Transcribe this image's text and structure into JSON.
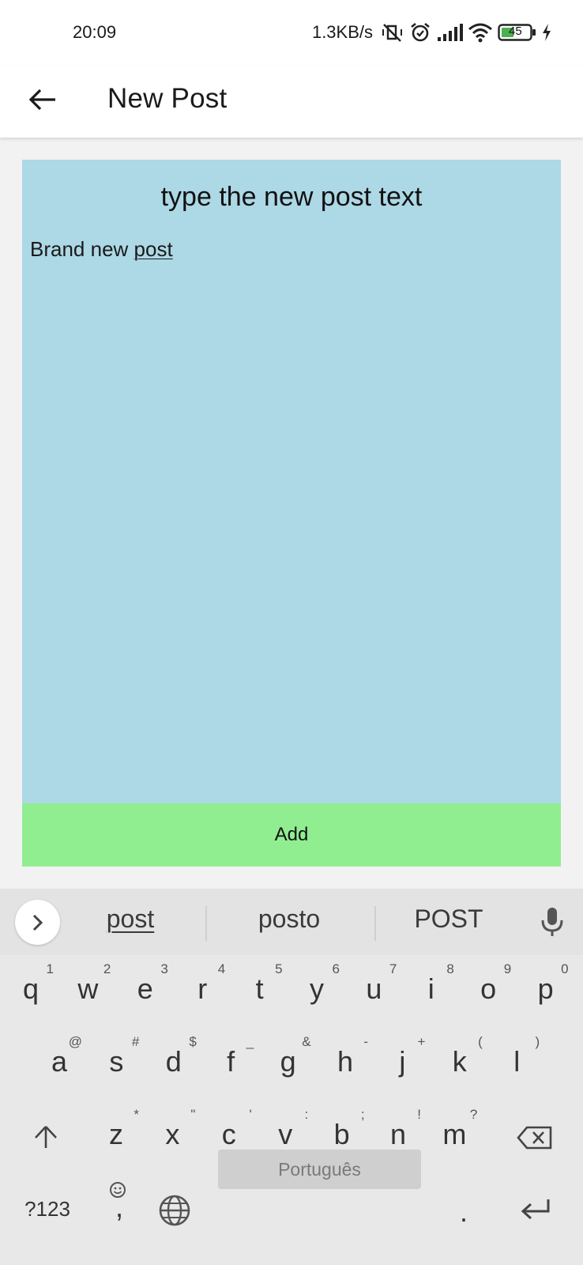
{
  "status_bar": {
    "time": "20:09",
    "net_speed": "1.3KB/s",
    "battery": "45",
    "icons": [
      "vibrate-off-icon",
      "alarm-icon",
      "signal-icon",
      "wifi-icon",
      "battery-icon",
      "charging-icon"
    ]
  },
  "app_bar": {
    "back_icon": "arrow-back-icon",
    "title": "New Post"
  },
  "editor": {
    "heading": "type the new post text",
    "text_prefix": "Brand new ",
    "text_composing": "post",
    "background": "#add8e6"
  },
  "add_button": {
    "label": "Add",
    "background": "#90ee90"
  },
  "keyboard": {
    "suggestions": [
      "post",
      "posto",
      "POST"
    ],
    "row1": [
      {
        "key": "q",
        "sup": "1"
      },
      {
        "key": "w",
        "sup": "2"
      },
      {
        "key": "e",
        "sup": "3"
      },
      {
        "key": "r",
        "sup": "4"
      },
      {
        "key": "t",
        "sup": "5"
      },
      {
        "key": "y",
        "sup": "6"
      },
      {
        "key": "u",
        "sup": "7"
      },
      {
        "key": "i",
        "sup": "8"
      },
      {
        "key": "o",
        "sup": "9"
      },
      {
        "key": "p",
        "sup": "0"
      }
    ],
    "row2": [
      {
        "key": "a",
        "sup": "@"
      },
      {
        "key": "s",
        "sup": "#"
      },
      {
        "key": "d",
        "sup": "$"
      },
      {
        "key": "f",
        "sup": "_"
      },
      {
        "key": "g",
        "sup": "&"
      },
      {
        "key": "h",
        "sup": "-"
      },
      {
        "key": "j",
        "sup": "+"
      },
      {
        "key": "k",
        "sup": "("
      },
      {
        "key": "l",
        "sup": ")"
      }
    ],
    "row3": [
      {
        "key": "z",
        "sup": "*"
      },
      {
        "key": "x",
        "sup": "\""
      },
      {
        "key": "c",
        "sup": "'"
      },
      {
        "key": "v",
        "sup": ":"
      },
      {
        "key": "b",
        "sup": ";"
      },
      {
        "key": "n",
        "sup": "!"
      },
      {
        "key": "m",
        "sup": "?"
      }
    ],
    "symbols_key": "?123",
    "comma_key": ",",
    "period_key": ".",
    "space_label": "Português"
  }
}
